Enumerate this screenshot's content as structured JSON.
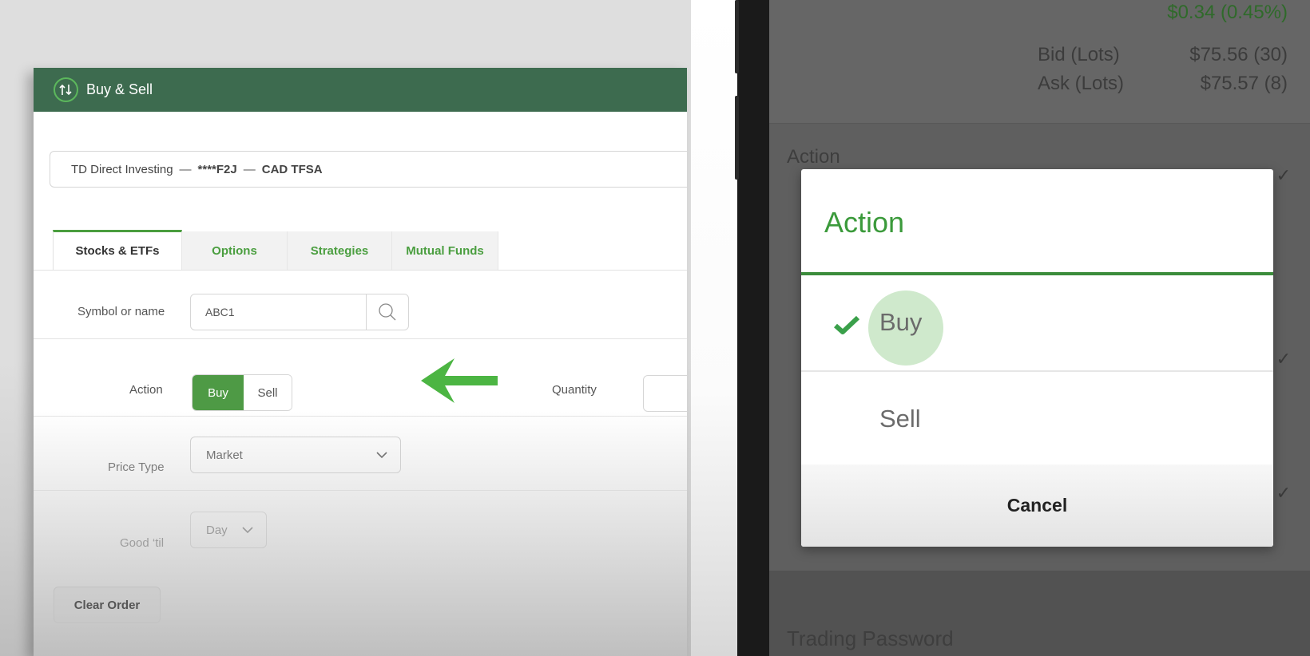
{
  "web": {
    "header": {
      "title": "Buy & Sell",
      "icon": "up-down-arrows-icon"
    },
    "account": {
      "broker": "TD Direct Investing",
      "account_number": "****F2J",
      "account_type": "CAD TFSA",
      "separator": "—"
    },
    "tabs": [
      {
        "label": "Stocks & ETFs",
        "active": true
      },
      {
        "label": "Options",
        "active": false
      },
      {
        "label": "Strategies",
        "active": false
      },
      {
        "label": "Mutual Funds",
        "active": false
      }
    ],
    "symbol": {
      "label": "Symbol or name",
      "value": "ABC1",
      "icon": "search-icon"
    },
    "action": {
      "label": "Action",
      "options": [
        "Buy",
        "Sell"
      ],
      "selected": "Buy"
    },
    "quantity": {
      "label": "Quantity",
      "value": ""
    },
    "price_type": {
      "label": "Price Type",
      "value": "Market"
    },
    "good_til": {
      "label": "Good ‘til",
      "value": "Day"
    },
    "clear_order": "Clear Order",
    "annotation": "left-arrow-icon"
  },
  "phone": {
    "change": "$0.34 (0.45%)",
    "bid": {
      "label": "Bid (Lots)",
      "value": "$75.56 (30)"
    },
    "ask": {
      "label": "Ask (Lots)",
      "value": "$75.57 (8)"
    },
    "background_fields": {
      "action": "Action",
      "trading_password": "Trading Password"
    },
    "dialog": {
      "title": "Action",
      "options": [
        {
          "label": "Buy",
          "selected": true
        },
        {
          "label": "Sell",
          "selected": false
        }
      ],
      "cancel": "Cancel"
    }
  },
  "colors": {
    "header_green": "#3d6b4f",
    "accent_green": "#4e9a45",
    "dialog_green": "#3b9a3b"
  }
}
